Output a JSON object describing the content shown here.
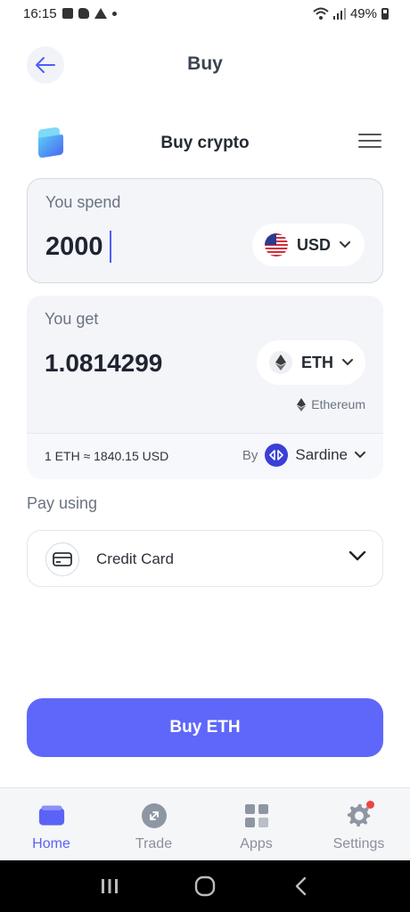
{
  "status_bar": {
    "time": "16:15",
    "battery": "49%"
  },
  "header": {
    "title": "Buy"
  },
  "widget": {
    "title": "Buy crypto"
  },
  "spend": {
    "label": "You spend",
    "amount": "2000",
    "currency": "USD"
  },
  "receive": {
    "label": "You get",
    "amount": "1.0814299",
    "currency": "ETH",
    "network": "Ethereum",
    "rate": "1 ETH ≈ 1840.15 USD",
    "by_label": "By",
    "provider": "Sardine"
  },
  "payment": {
    "label": "Pay using",
    "method": "Credit Card"
  },
  "buy_button": {
    "label": "Buy ETH"
  },
  "bottom_nav": {
    "items": [
      {
        "label": "Home",
        "icon": "wallet-icon",
        "active": true
      },
      {
        "label": "Trade",
        "icon": "trade-arrows-icon",
        "active": false
      },
      {
        "label": "Apps",
        "icon": "grid-icon",
        "active": false
      },
      {
        "label": "Settings",
        "icon": "gear-icon",
        "active": false
      }
    ]
  },
  "colors": {
    "accent": "#5f67fa",
    "card_bg": "#f3f5f9",
    "notification": "#ef4444"
  }
}
